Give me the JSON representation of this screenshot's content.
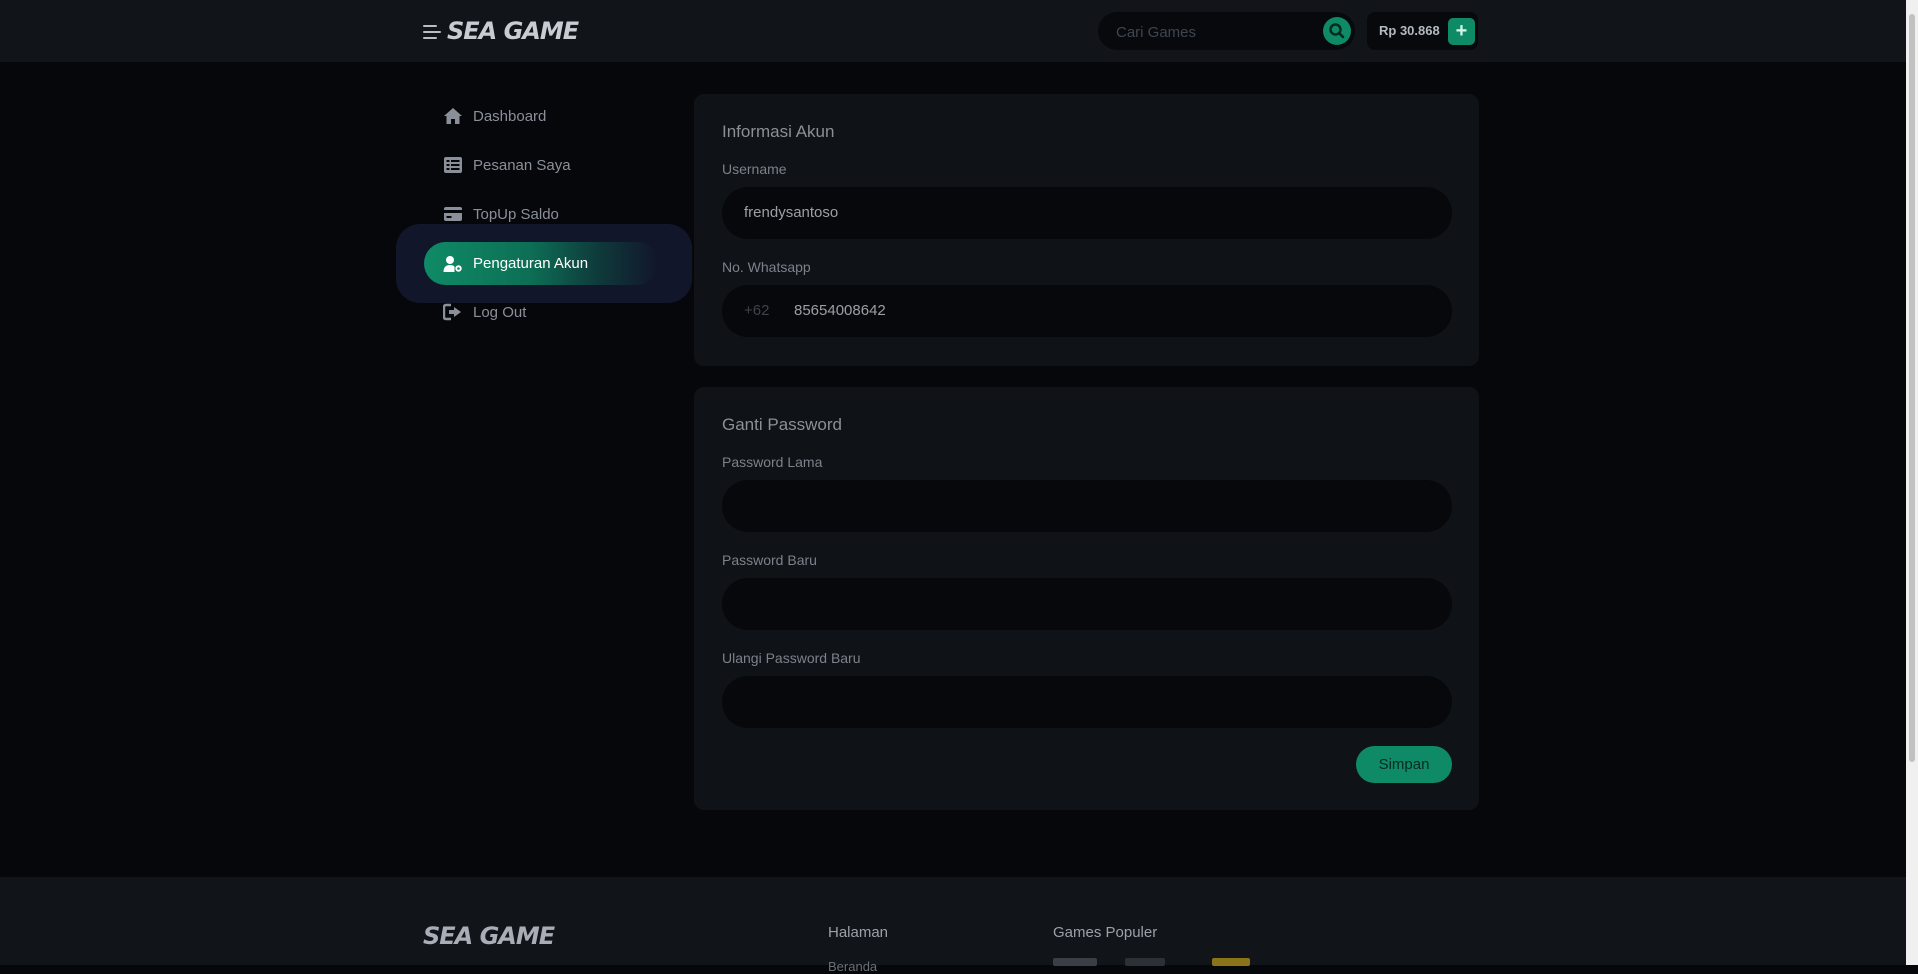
{
  "header": {
    "logo": "SEA GAME",
    "search_placeholder": "Cari Games",
    "balance": "Rp 30.868",
    "topup_icon": "+"
  },
  "sidebar": {
    "items": [
      {
        "label": "Dashboard",
        "icon": "home-icon"
      },
      {
        "label": "Pesanan Saya",
        "icon": "list-icon"
      },
      {
        "label": "TopUp Saldo",
        "icon": "credit-card-icon"
      },
      {
        "label": "Pengaturan Akun",
        "icon": "user-gear-icon",
        "active": true
      },
      {
        "label": "Log Out",
        "icon": "logout-icon"
      }
    ]
  },
  "account_info": {
    "title": "Informasi Akun",
    "username_label": "Username",
    "username_value": "frendysantoso",
    "whatsapp_label": "No. Whatsapp",
    "whatsapp_prefix": "+62",
    "whatsapp_value": "85654008642"
  },
  "change_password": {
    "title": "Ganti Password",
    "old_label": "Password Lama",
    "new_label": "Password Baru",
    "repeat_label": "Ulangi Password Baru",
    "save_label": "Simpan"
  },
  "footer": {
    "logo": "SEA GAME",
    "pages_heading": "Halaman",
    "pages_first_link": "Beranda",
    "games_heading": "Games Populer"
  },
  "colors": {
    "accent": "#0f8a66",
    "background": "#05070b",
    "card": "#0f1216"
  }
}
